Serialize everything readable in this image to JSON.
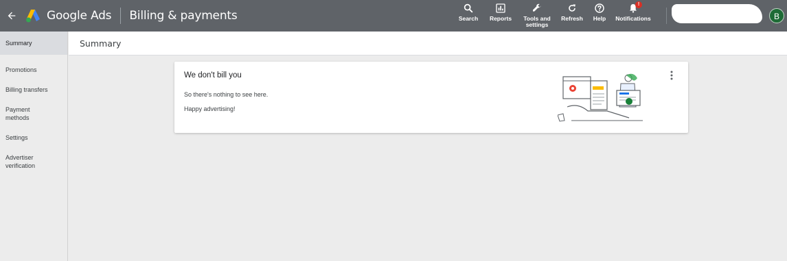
{
  "header": {
    "product_name": "Google Ads",
    "page_heading": "Billing & payments",
    "tools": {
      "search": "Search",
      "reports": "Reports",
      "tools_line1": "Tools and",
      "tools_line2": "settings",
      "refresh": "Refresh",
      "help": "Help",
      "notifications": "Notifications"
    },
    "notification_count": "!",
    "avatar_initial": "B"
  },
  "sidebar": {
    "items": [
      {
        "label": "Summary"
      },
      {
        "label": "Promotions"
      },
      {
        "label": "Billing transfers"
      },
      {
        "label_line1": "Payment",
        "label_line2": "methods"
      },
      {
        "label": "Settings"
      },
      {
        "label_line1": "Advertiser",
        "label_line2": "verification"
      }
    ]
  },
  "main": {
    "section_title": "Summary",
    "card": {
      "title": "We don't bill you",
      "line1": "So there's nothing to see here.",
      "line2": "Happy advertising!"
    }
  },
  "colors": {
    "topbar": "#5f6368",
    "accent_green": "#1e6b36",
    "badge_red": "#d93025"
  },
  "icons": [
    "back-arrow-icon",
    "google-ads-logo-icon",
    "search-icon",
    "reports-icon",
    "wrench-icon",
    "refresh-icon",
    "help-icon",
    "bell-icon",
    "more-vert-icon"
  ]
}
